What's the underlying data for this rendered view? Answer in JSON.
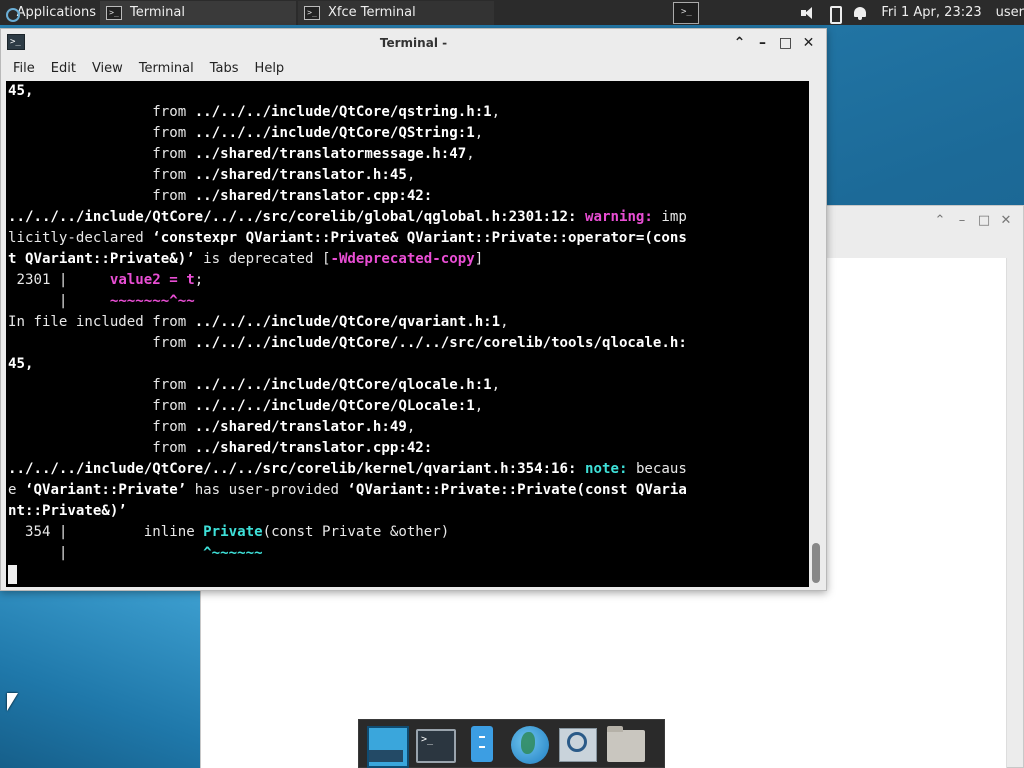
{
  "top_panel": {
    "applications_label": "Applications",
    "tasks": [
      {
        "label": "Terminal"
      },
      {
        "label": "Xfce Terminal"
      }
    ],
    "clock": "Fri  1 Apr, 23:23",
    "user": "user"
  },
  "terminal_window": {
    "title": "Terminal -",
    "menu": [
      "File",
      "Edit",
      "View",
      "Terminal",
      "Tabs",
      "Help"
    ],
    "lines": {
      "l01": "45,",
      "l02_pre": "                 from ",
      "l02_b": "../../../include/QtCore/qstring.h:1",
      "l03_pre": "                 from ",
      "l03_b": "../../../include/QtCore/QString:1",
      "l04_pre": "                 from ",
      "l04_b": "../shared/translatormessage.h:47",
      "l05_pre": "                 from ",
      "l05_b": "../shared/translator.h:45",
      "l06_pre": "                 from ",
      "l06_b": "../shared/translator.cpp:42:",
      "l07_b": "../../../include/QtCore/../../src/corelib/global/qglobal.h:2301:12:",
      "l07_warn": "warning:",
      "l07_rest": " imp",
      "l08_a": "licitly-declared ",
      "l08_b": "‘constexpr QVariant::Private& QVariant::Private::operator=(cons",
      "l09_b": "t QVariant::Private&)’",
      "l09_rest": " is deprecated [",
      "l09_flag": "-Wdeprecated-copy",
      "l09_end": "]",
      "l10_pre": " 2301 |     ",
      "l10_code": "value2 = t",
      "l10_end": ";",
      "l11_pre": "      |     ",
      "l11_mark": "~~~~~~~^~~",
      "l12_pre": "In file included from ",
      "l12_b": "../../../include/QtCore/qvariant.h:1",
      "l13_pre": "                 from ",
      "l13_b": "../../../include/QtCore/../../src/corelib/tools/qlocale.h:",
      "l14": "45,",
      "l15_pre": "                 from ",
      "l15_b": "../../../include/QtCore/qlocale.h:1",
      "l16_pre": "                 from ",
      "l16_b": "../../../include/QtCore/QLocale:1",
      "l17_pre": "                 from ",
      "l17_b": "../shared/translator.h:49",
      "l18_pre": "                 from ",
      "l18_b": "../shared/translator.cpp:42:",
      "l19_b": "../../../include/QtCore/../../src/corelib/kernel/qvariant.h:354:16:",
      "l19_note": "note:",
      "l19_rest": " becaus",
      "l20_a": "e ",
      "l20_b1": "‘QVariant::Private’",
      "l20_mid": " has user-provided ",
      "l20_b2": "‘QVariant::Private::Private(const QVaria",
      "l21_b": "nt::Private&)’",
      "l22_pre": "  354 |         inline ",
      "l22_code": "Private",
      "l22_end": "(const Private &other)",
      "l23_pre": "      |                ",
      "l23_mark": "^~~~~~~"
    }
  }
}
